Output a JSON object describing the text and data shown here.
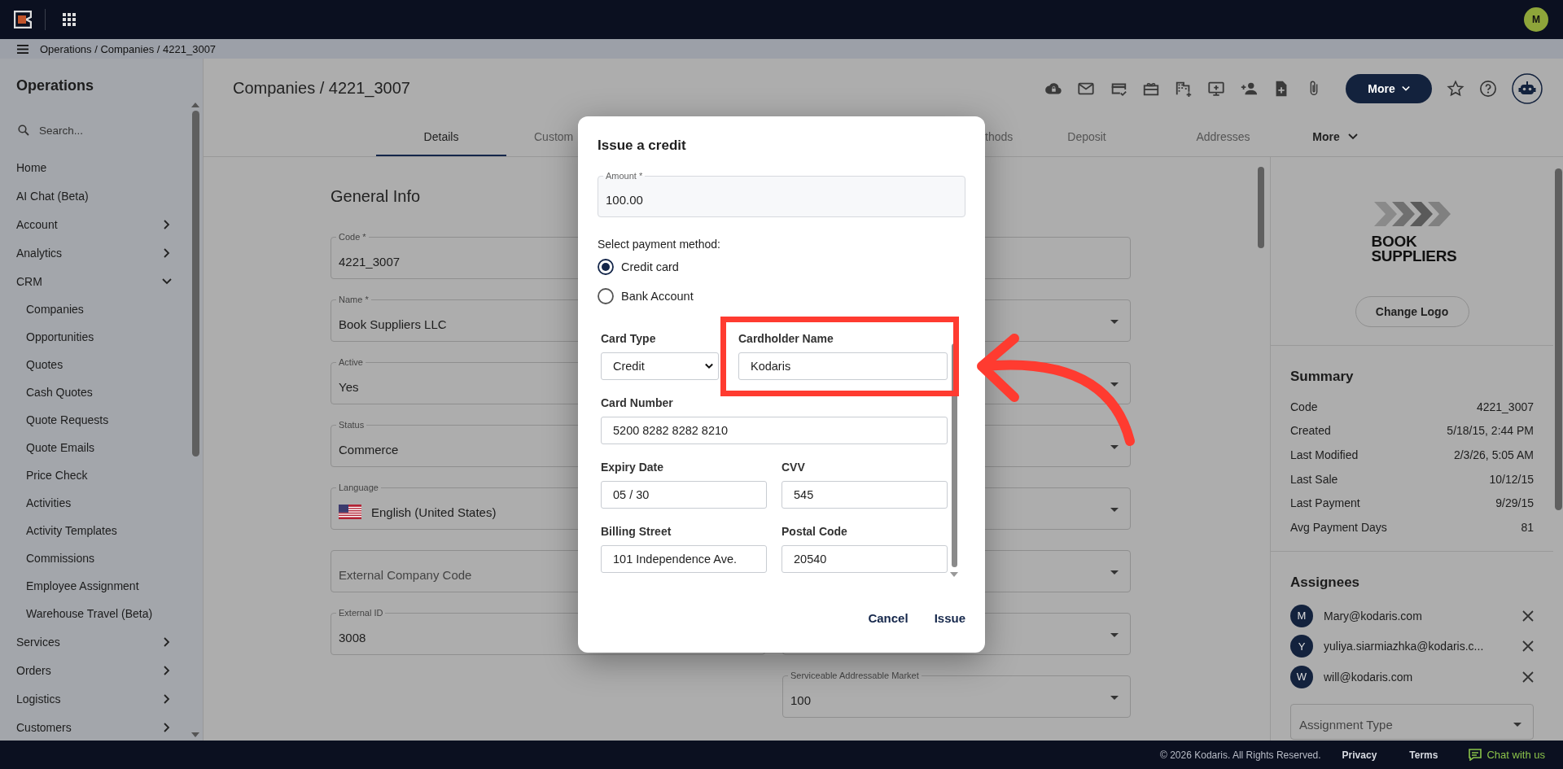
{
  "topbar": {
    "avatar": "M"
  },
  "breadcrumb": "Operations / Companies / 4221_3007",
  "sidebar": {
    "title": "Operations",
    "search_placeholder": "Search...",
    "items": [
      {
        "label": "Home"
      },
      {
        "label": "AI Chat (Beta)"
      },
      {
        "label": "Account",
        "expanded": false
      },
      {
        "label": "Analytics",
        "expanded": false
      },
      {
        "label": "CRM",
        "expanded": true,
        "children": [
          {
            "label": "Companies"
          },
          {
            "label": "Opportunities"
          },
          {
            "label": "Quotes"
          },
          {
            "label": "Cash Quotes"
          },
          {
            "label": "Quote Requests"
          },
          {
            "label": "Quote Emails"
          },
          {
            "label": "Price Check"
          },
          {
            "label": "Activities"
          },
          {
            "label": "Activity Templates"
          },
          {
            "label": "Commissions"
          },
          {
            "label": "Employee Assignment"
          },
          {
            "label": "Warehouse Travel (Beta)"
          }
        ]
      },
      {
        "label": "Services",
        "expanded": false
      },
      {
        "label": "Orders",
        "expanded": false
      },
      {
        "label": "Logistics",
        "expanded": false
      },
      {
        "label": "Customers",
        "expanded": false
      }
    ]
  },
  "page": {
    "title": "Companies / 4221_3007",
    "more_button": "More"
  },
  "tabs": [
    {
      "label": "Details",
      "selected": true,
      "kind": "tab"
    },
    {
      "label": "Custom",
      "selected": false,
      "kind": "tab"
    },
    {
      "label": "thods",
      "selected": false,
      "kind": "tab"
    },
    {
      "label": "Deposit",
      "selected": false,
      "kind": "tab"
    },
    {
      "label": "Addresses",
      "selected": false,
      "kind": "tab"
    },
    {
      "label": "More",
      "selected": false,
      "kind": "menu"
    }
  ],
  "form": {
    "title": "General Info",
    "left_fields": [
      {
        "kind": "text",
        "label": "Code *",
        "value": "4221_3007"
      },
      {
        "kind": "text",
        "label": "Name *",
        "value": "Book Suppliers LLC"
      },
      {
        "kind": "text",
        "label": "Active",
        "value": "Yes"
      },
      {
        "kind": "text",
        "label": "Status",
        "value": "Commerce"
      },
      {
        "kind": "language",
        "label": "Language",
        "value": "English (United States)"
      },
      {
        "kind": "text",
        "placeholder": "External Company Code"
      },
      {
        "kind": "text",
        "label": "External ID",
        "value": "3008"
      }
    ],
    "right_fields": [
      {
        "dropdown": false
      },
      {
        "dropdown": true
      },
      {
        "dropdown": true
      },
      {
        "dropdown": true
      },
      {
        "dropdown": true
      },
      {
        "dropdown": true
      },
      {
        "dropdown": true
      },
      {
        "dropdown": true,
        "label": "Serviceable Addressable Market",
        "value": "100"
      }
    ]
  },
  "right_panel": {
    "logo_text": "BOOK SUPPLIERS",
    "change_logo": "Change Logo",
    "summary": {
      "title": "Summary",
      "rows": [
        {
          "label": "Code",
          "value": "4221_3007"
        },
        {
          "label": "Created",
          "value": "5/18/15, 2:44 PM"
        },
        {
          "label": "Last Modified",
          "value": "2/3/26, 5:05 AM"
        },
        {
          "label": "Last Sale",
          "value": "10/12/15"
        },
        {
          "label": "Last Payment",
          "value": "9/29/15"
        },
        {
          "label": "Avg Payment Days",
          "value": "81"
        }
      ]
    },
    "assignees": {
      "title": "Assignees",
      "people": [
        {
          "initial": "M",
          "email": "Mary@kodaris.com"
        },
        {
          "initial": "Y",
          "email": "yuliya.siarmiazhka@kodaris.c..."
        },
        {
          "initial": "W",
          "email": "will@kodaris.com"
        }
      ],
      "assignment_placeholder": "Assignment Type"
    }
  },
  "dialog": {
    "title": "Issue a credit",
    "amount": {
      "label": "Amount *",
      "value": "100.00"
    },
    "method_prompt": "Select payment method:",
    "payment_methods": [
      {
        "label": "Credit card",
        "selected": true
      },
      {
        "label": "Bank Account",
        "selected": false
      }
    ],
    "rows": [
      {
        "fields": [
          {
            "kind": "select",
            "label": "Card Type",
            "value": "Credit",
            "highlighted": false
          },
          {
            "kind": "text",
            "label": "Cardholder Name",
            "value": "Kodaris",
            "highlighted": true
          }
        ]
      },
      {
        "fields": [
          {
            "kind": "text",
            "label": "Card Number",
            "value": "5200 8282 8282 8210",
            "highlighted": false
          }
        ]
      },
      {
        "fields": [
          {
            "kind": "text",
            "label": "Expiry Date",
            "value": "05 / 30",
            "highlighted": false
          },
          {
            "kind": "text",
            "label": "CVV",
            "value": "545",
            "highlighted": false
          }
        ]
      },
      {
        "fields": [
          {
            "kind": "text",
            "label": "Billing Street",
            "value": "101 Independence Ave.",
            "highlighted": false
          },
          {
            "kind": "text",
            "label": "Postal Code",
            "value": "20540",
            "highlighted": false
          }
        ]
      }
    ],
    "buttons": [
      "Cancel",
      "Issue"
    ]
  },
  "footer": {
    "copyright": "© 2026 Kodaris. All Rights Reserved.",
    "links": [
      "Privacy",
      "Terms"
    ],
    "chat": "Chat with us"
  }
}
